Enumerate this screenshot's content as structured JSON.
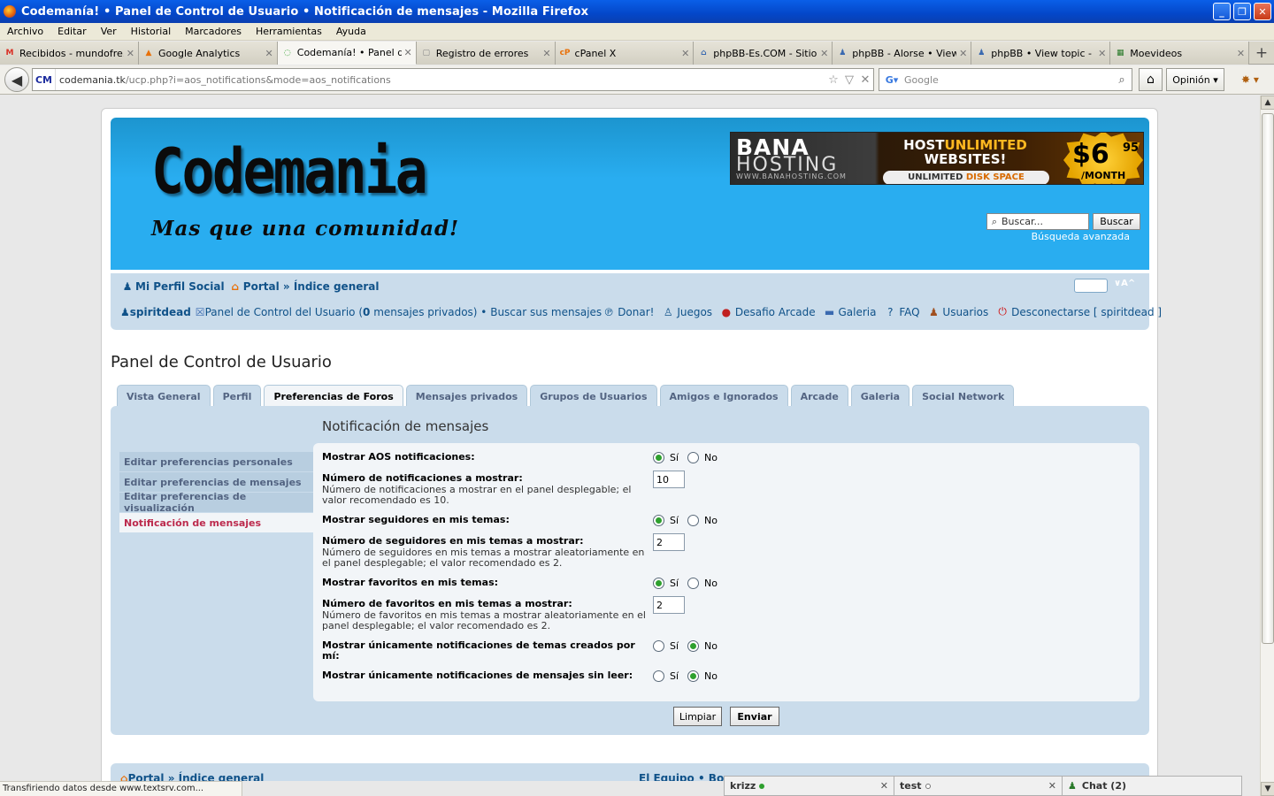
{
  "window": {
    "title": "Codemanía! • Panel de Control de Usuario • Notificación de mensajes - Mozilla Firefox"
  },
  "menu": [
    "Archivo",
    "Editar",
    "Ver",
    "Historial",
    "Marcadores",
    "Herramientas",
    "Ayuda"
  ],
  "browser_tabs": [
    {
      "label": "Recibidos - mundofre...",
      "icon": "gmail-icon",
      "glyph": "M",
      "color": "#d93025"
    },
    {
      "label": "Google Analytics",
      "icon": "analytics-icon",
      "glyph": "▲",
      "color": "#e8710a"
    },
    {
      "label": "Codemanía! • Panel d...",
      "icon": "loading-icon",
      "glyph": "◌",
      "color": "#2ea02e"
    },
    {
      "label": "Registro de errores",
      "icon": "page-icon",
      "glyph": "▢",
      "color": "#888888"
    },
    {
      "label": "cPanel X",
      "icon": "cpanel-icon",
      "glyph": "cP",
      "color": "#e8710a"
    },
    {
      "label": "phpBB-Es.COM - Sitio...",
      "icon": "phpbb-icon",
      "glyph": "⌂",
      "color": "#3a6ab0"
    },
    {
      "label": "phpBB - Alorse • View...",
      "icon": "phpbb-users-icon",
      "glyph": "♟",
      "color": "#3a6ab0"
    },
    {
      "label": "phpBB • View topic - [...",
      "icon": "phpbb-users-icon",
      "glyph": "♟",
      "color": "#3a6ab0"
    },
    {
      "label": "Moevideos",
      "icon": "moevideos-icon",
      "glyph": "▦",
      "color": "#2a7a2a"
    }
  ],
  "nav": {
    "url_host": "codemania.tk",
    "url_path": "/ucp.php?i=aos_notifications&mode=aos_notifications",
    "search_placeholder": "Google",
    "opinion": "Opinión"
  },
  "header": {
    "logo_title": "Codemania",
    "logo_subtitle": "Mas que una comunidad!",
    "banner": {
      "brand1": "BANA",
      "brand2": "HOSTING",
      "brand_url": "WWW.BANAHOSTING.COM",
      "host_a": "HOST",
      "host_b": "UNLIMITED",
      "websites": "WEBSITES!",
      "pill_a": "UNLIMITED",
      "pill_b": "DISK SPACE",
      "price": "$6",
      "cents": "95",
      "per": "/MONTH"
    },
    "search_placeholder": "Buscar...",
    "search_button": "Buscar",
    "advanced": "Búsqueda avanzada"
  },
  "breadcrumbs": {
    "social": "Mi Perfil Social",
    "portal": "Portal",
    "sep": "»",
    "index": "Índice general"
  },
  "userline": {
    "user": "spiritdead",
    "ucp_a": "Panel de Control del Usuario (",
    "pm_count": "0",
    "ucp_b": " mensajes privados) •",
    "search_own": "Buscar sus mensajes",
    "donate": "Donar!",
    "games": "Juegos",
    "arcade": "Desafio Arcade",
    "gallery": "Galeria",
    "faq": "FAQ",
    "users": "Usuarios",
    "logout": "Desconectarse [ spiritdead ]"
  },
  "page_title": "Panel de Control de Usuario",
  "ucp_tabs": [
    {
      "label": "Vista General",
      "active": false
    },
    {
      "label": "Perfil",
      "active": false
    },
    {
      "label": "Preferencias de Foros",
      "active": true
    },
    {
      "label": "Mensajes privados",
      "active": false
    },
    {
      "label": "Grupos de Usuarios",
      "active": false
    },
    {
      "label": "Amigos e Ignorados",
      "active": false
    },
    {
      "label": "Arcade",
      "active": false
    },
    {
      "label": "Galeria",
      "active": false
    },
    {
      "label": "Social Network",
      "active": false
    }
  ],
  "sidenav": [
    {
      "label": "Editar preferencias personales",
      "active": false
    },
    {
      "label": "Editar preferencias de mensajes",
      "active": false
    },
    {
      "label": "Editar preferencias de visualización",
      "active": false
    },
    {
      "label": "Notificación de mensajes",
      "active": true
    }
  ],
  "form": {
    "title": "Notificación de mensajes",
    "yes": "Sí",
    "no": "No",
    "rows": [
      {
        "label": "Mostrar AOS notificaciones:",
        "type": "radio",
        "value": "yes"
      },
      {
        "label": "Número de notificaciones a mostrar:",
        "desc": "Número de notificaciones a mostrar en el panel desplegable; el valor recomendado es 10.",
        "type": "number",
        "value": "10"
      },
      {
        "label": "Mostrar seguidores en mis temas:",
        "type": "radio",
        "value": "yes"
      },
      {
        "label": "Número de seguidores en mis temas a mostrar:",
        "desc": "Número de seguidores en mis temas a mostrar aleatoriamente en el panel desplegable; el valor recomendado es 2.",
        "type": "number",
        "value": "2"
      },
      {
        "label": "Mostrar favoritos en mis temas:",
        "type": "radio",
        "value": "yes"
      },
      {
        "label": "Número de favoritos en mis temas a mostrar:",
        "desc": "Número de favoritos en mis temas a mostrar aleatoriamente en el panel desplegable; el valor recomendado es 2.",
        "type": "number",
        "value": "2"
      },
      {
        "label": "Mostrar únicamente notificaciones de temas creados por mí:",
        "type": "radio",
        "value": "no"
      },
      {
        "label": "Mostrar únicamente notificaciones de mensajes sin leer:",
        "type": "radio",
        "value": "no"
      }
    ],
    "clear_button": "Limpiar",
    "submit_button": "Enviar"
  },
  "footer": {
    "portal": "Portal",
    "sep": "»",
    "index": "Índice general",
    "team": "El Equipo • Bor"
  },
  "status_text": "Transfiriendo datos desde www.textsrv.com...",
  "chat": [
    {
      "name": "krizz",
      "status_color": "#2ea02e"
    },
    {
      "name": "test",
      "status_color": "#ffffff"
    }
  ],
  "chat_main": "Chat (2)"
}
